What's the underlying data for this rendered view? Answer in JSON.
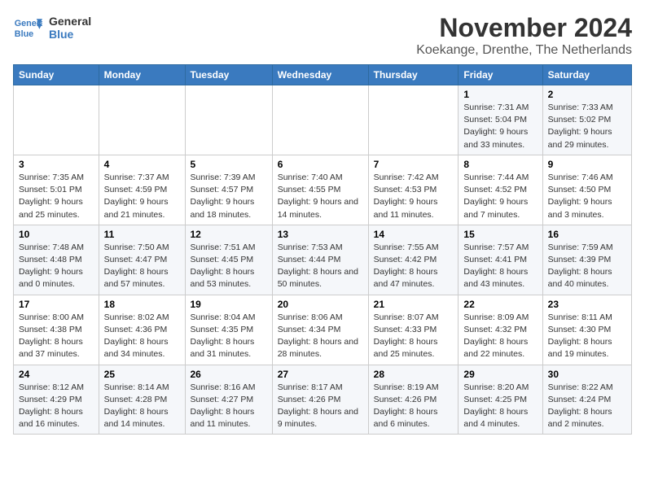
{
  "header": {
    "logo_line1": "General",
    "logo_line2": "Blue",
    "month": "November 2024",
    "location": "Koekange, Drenthe, The Netherlands"
  },
  "days_of_week": [
    "Sunday",
    "Monday",
    "Tuesday",
    "Wednesday",
    "Thursday",
    "Friday",
    "Saturday"
  ],
  "weeks": [
    [
      {
        "day": "",
        "info": ""
      },
      {
        "day": "",
        "info": ""
      },
      {
        "day": "",
        "info": ""
      },
      {
        "day": "",
        "info": ""
      },
      {
        "day": "",
        "info": ""
      },
      {
        "day": "1",
        "info": "Sunrise: 7:31 AM\nSunset: 5:04 PM\nDaylight: 9 hours and 33 minutes."
      },
      {
        "day": "2",
        "info": "Sunrise: 7:33 AM\nSunset: 5:02 PM\nDaylight: 9 hours and 29 minutes."
      }
    ],
    [
      {
        "day": "3",
        "info": "Sunrise: 7:35 AM\nSunset: 5:01 PM\nDaylight: 9 hours and 25 minutes."
      },
      {
        "day": "4",
        "info": "Sunrise: 7:37 AM\nSunset: 4:59 PM\nDaylight: 9 hours and 21 minutes."
      },
      {
        "day": "5",
        "info": "Sunrise: 7:39 AM\nSunset: 4:57 PM\nDaylight: 9 hours and 18 minutes."
      },
      {
        "day": "6",
        "info": "Sunrise: 7:40 AM\nSunset: 4:55 PM\nDaylight: 9 hours and 14 minutes."
      },
      {
        "day": "7",
        "info": "Sunrise: 7:42 AM\nSunset: 4:53 PM\nDaylight: 9 hours and 11 minutes."
      },
      {
        "day": "8",
        "info": "Sunrise: 7:44 AM\nSunset: 4:52 PM\nDaylight: 9 hours and 7 minutes."
      },
      {
        "day": "9",
        "info": "Sunrise: 7:46 AM\nSunset: 4:50 PM\nDaylight: 9 hours and 3 minutes."
      }
    ],
    [
      {
        "day": "10",
        "info": "Sunrise: 7:48 AM\nSunset: 4:48 PM\nDaylight: 9 hours and 0 minutes."
      },
      {
        "day": "11",
        "info": "Sunrise: 7:50 AM\nSunset: 4:47 PM\nDaylight: 8 hours and 57 minutes."
      },
      {
        "day": "12",
        "info": "Sunrise: 7:51 AM\nSunset: 4:45 PM\nDaylight: 8 hours and 53 minutes."
      },
      {
        "day": "13",
        "info": "Sunrise: 7:53 AM\nSunset: 4:44 PM\nDaylight: 8 hours and 50 minutes."
      },
      {
        "day": "14",
        "info": "Sunrise: 7:55 AM\nSunset: 4:42 PM\nDaylight: 8 hours and 47 minutes."
      },
      {
        "day": "15",
        "info": "Sunrise: 7:57 AM\nSunset: 4:41 PM\nDaylight: 8 hours and 43 minutes."
      },
      {
        "day": "16",
        "info": "Sunrise: 7:59 AM\nSunset: 4:39 PM\nDaylight: 8 hours and 40 minutes."
      }
    ],
    [
      {
        "day": "17",
        "info": "Sunrise: 8:00 AM\nSunset: 4:38 PM\nDaylight: 8 hours and 37 minutes."
      },
      {
        "day": "18",
        "info": "Sunrise: 8:02 AM\nSunset: 4:36 PM\nDaylight: 8 hours and 34 minutes."
      },
      {
        "day": "19",
        "info": "Sunrise: 8:04 AM\nSunset: 4:35 PM\nDaylight: 8 hours and 31 minutes."
      },
      {
        "day": "20",
        "info": "Sunrise: 8:06 AM\nSunset: 4:34 PM\nDaylight: 8 hours and 28 minutes."
      },
      {
        "day": "21",
        "info": "Sunrise: 8:07 AM\nSunset: 4:33 PM\nDaylight: 8 hours and 25 minutes."
      },
      {
        "day": "22",
        "info": "Sunrise: 8:09 AM\nSunset: 4:32 PM\nDaylight: 8 hours and 22 minutes."
      },
      {
        "day": "23",
        "info": "Sunrise: 8:11 AM\nSunset: 4:30 PM\nDaylight: 8 hours and 19 minutes."
      }
    ],
    [
      {
        "day": "24",
        "info": "Sunrise: 8:12 AM\nSunset: 4:29 PM\nDaylight: 8 hours and 16 minutes."
      },
      {
        "day": "25",
        "info": "Sunrise: 8:14 AM\nSunset: 4:28 PM\nDaylight: 8 hours and 14 minutes."
      },
      {
        "day": "26",
        "info": "Sunrise: 8:16 AM\nSunset: 4:27 PM\nDaylight: 8 hours and 11 minutes."
      },
      {
        "day": "27",
        "info": "Sunrise: 8:17 AM\nSunset: 4:26 PM\nDaylight: 8 hours and 9 minutes."
      },
      {
        "day": "28",
        "info": "Sunrise: 8:19 AM\nSunset: 4:26 PM\nDaylight: 8 hours and 6 minutes."
      },
      {
        "day": "29",
        "info": "Sunrise: 8:20 AM\nSunset: 4:25 PM\nDaylight: 8 hours and 4 minutes."
      },
      {
        "day": "30",
        "info": "Sunrise: 8:22 AM\nSunset: 4:24 PM\nDaylight: 8 hours and 2 minutes."
      }
    ]
  ]
}
